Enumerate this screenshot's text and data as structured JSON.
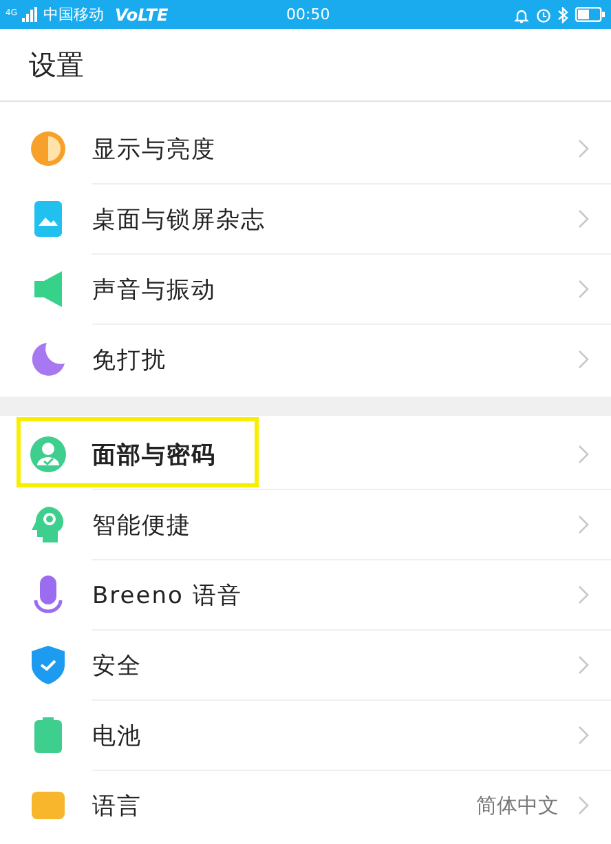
{
  "status_bar": {
    "network": "4G",
    "carrier": "中国移动",
    "volte": "VoLTE",
    "time": "00:50"
  },
  "header": {
    "title": "设置"
  },
  "sections": [
    {
      "items": [
        {
          "label": "显示与亮度",
          "highlighted": false
        },
        {
          "label": "桌面与锁屏杂志",
          "highlighted": false
        },
        {
          "label": "声音与振动",
          "highlighted": false
        },
        {
          "label": "免打扰",
          "highlighted": false
        }
      ]
    },
    {
      "items": [
        {
          "label": "面部与密码",
          "highlighted": true
        },
        {
          "label": "智能便捷",
          "highlighted": false
        },
        {
          "label": "Breeno 语音",
          "highlighted": false
        },
        {
          "label": "安全",
          "highlighted": false
        },
        {
          "label": "电池",
          "highlighted": false
        },
        {
          "label": "语言",
          "value": "简体中文",
          "highlighted": false
        }
      ]
    }
  ]
}
